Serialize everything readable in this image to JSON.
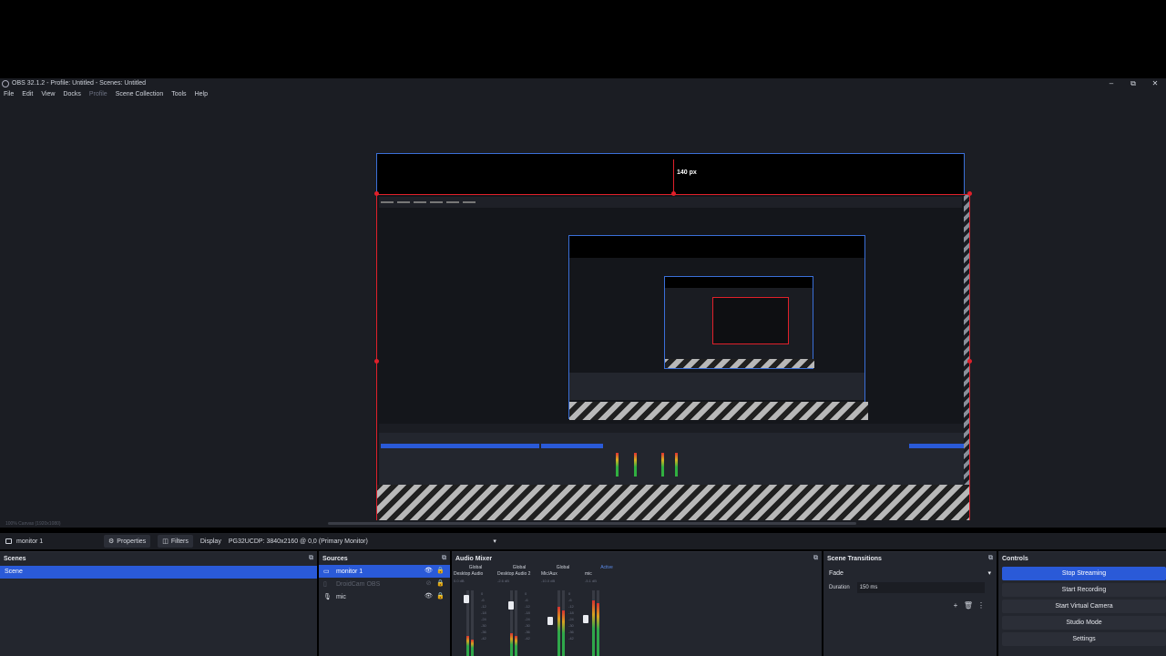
{
  "window": {
    "title": "OBS 32.1.2 - Profile: Untitled - Scenes: Untitled",
    "minimize": "–",
    "maximize": "⧉",
    "close": "✕"
  },
  "menu": [
    "File",
    "Edit",
    "View",
    "Docks",
    "Profile",
    "Scene Collection",
    "Tools",
    "Help"
  ],
  "preview": {
    "crop_label": "140 px",
    "zoom_text": "100%   Canvas (1920x1080)"
  },
  "toolbar": {
    "source_name": "monitor 1",
    "properties_label": "Properties",
    "filters_label": "Filters",
    "display_label": "Display",
    "display_value": "PG32UCDP: 3840x2160 @ 0,0 (Primary Monitor)"
  },
  "scenes": {
    "title": "Scenes",
    "items": [
      "Scene"
    ]
  },
  "sources": {
    "title": "Sources",
    "items": [
      {
        "name": "monitor 1",
        "icon": "monitor-icon",
        "selected": true
      },
      {
        "name": "DroidCam OBS",
        "icon": "camera-icon",
        "selected": false
      },
      {
        "name": "mic",
        "icon": "microphone-icon",
        "selected": false
      }
    ]
  },
  "audio_mixer": {
    "title": "Audio Mixer",
    "channels": [
      {
        "global": "Global",
        "name": "Desktop Audio",
        "db": "0.0 dB",
        "level": 0.3
      },
      {
        "global": "Global",
        "name": "Desktop Audio 2",
        "db": "-2.6 dB",
        "level": 0.35
      },
      {
        "global": "Global",
        "name": "Mic/Aux",
        "db": "-10.0 dB",
        "level": 0.75
      },
      {
        "global": "Active",
        "name": "mic",
        "db": "-5.1 dB",
        "level": 0.85
      }
    ],
    "scale": [
      "0",
      "-6",
      "-12",
      "-18",
      "-24",
      "-30",
      "-36",
      "-42",
      "-48",
      "-54",
      "-60"
    ]
  },
  "transitions": {
    "title": "Scene Transitions",
    "selected": "Fade",
    "duration_label": "Duration",
    "duration_value": "150 ms"
  },
  "controls": {
    "title": "Controls",
    "buttons": [
      "Stop Streaming",
      "Start Recording",
      "Start Virtual Camera",
      "Studio Mode",
      "Settings"
    ]
  },
  "colors": {
    "accent": "#2a5ad8",
    "crop_red": "#e0202a",
    "bounds_blue": "#3a6fd8",
    "dock_bg": "#23262e",
    "window_bg": "#1b1d23"
  }
}
